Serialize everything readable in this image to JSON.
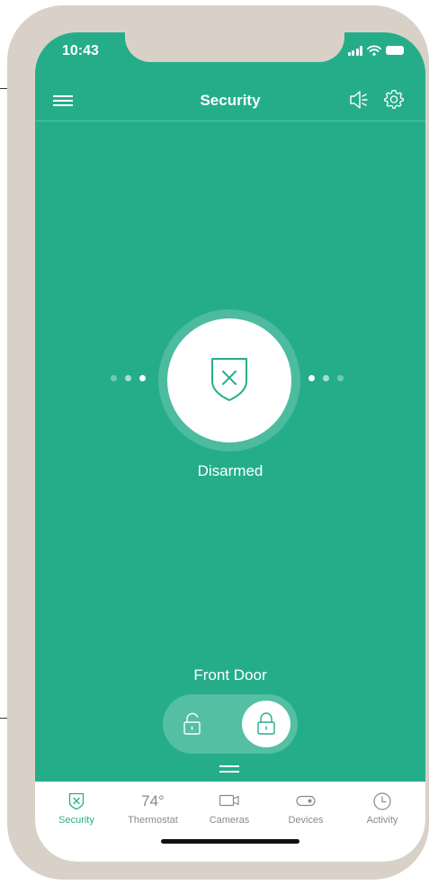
{
  "colors": {
    "accent": "#25ad8a",
    "frame": "#d9d1c8",
    "tab_inactive": "#8a8a8a"
  },
  "status_bar": {
    "time": "10:43"
  },
  "nav": {
    "title": "Security",
    "menu_icon": "hamburger-menu-icon",
    "speaker_icon": "speaker-icon",
    "settings_icon": "gear-icon"
  },
  "security": {
    "mode": "Disarmed",
    "icon": "shield-x-icon"
  },
  "lock": {
    "title": "Front Door",
    "state": "locked"
  },
  "tabs": [
    {
      "label": "Security",
      "icon": "shield-x-icon",
      "active": true
    },
    {
      "label": "Thermostat",
      "value": "74°",
      "active": false
    },
    {
      "label": "Cameras",
      "icon": "camera-icon",
      "active": false
    },
    {
      "label": "Devices",
      "icon": "toggle-icon",
      "active": false
    },
    {
      "label": "Activity",
      "icon": "clock-icon",
      "active": false
    }
  ]
}
